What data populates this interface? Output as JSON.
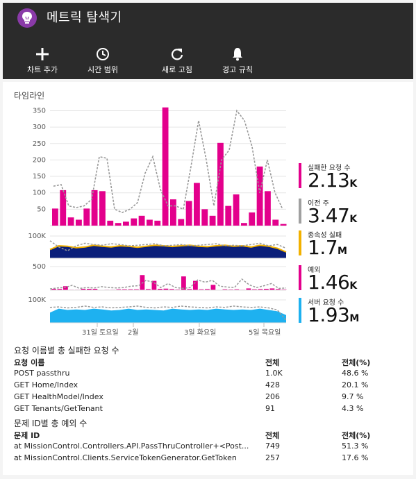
{
  "app": {
    "title": "메트릭 탐색기"
  },
  "toolbar": {
    "add_chart": "차트 추가",
    "time_range": "시간 범위",
    "refresh": "새로 고침",
    "alert_rules": "경고 규칙"
  },
  "timeline": {
    "title": "타임라인",
    "x_ticks": [
      "31일 토요일",
      "2월",
      "3일 화요일",
      "5일 목요일"
    ]
  },
  "chart_data": [
    {
      "type": "bar",
      "title": "",
      "ylim": [
        0,
        370
      ],
      "y_ticks": [
        50,
        100,
        150,
        200,
        250,
        300,
        350
      ],
      "series": [
        {
          "name": "실패한 요청 수",
          "values": [
            52,
            108,
            25,
            18,
            52,
            108,
            105,
            15,
            8,
            12,
            22,
            30,
            18,
            15,
            360,
            80,
            20,
            75,
            130,
            50,
            30,
            252,
            60,
            95,
            8,
            40,
            180,
            105,
            18,
            5
          ]
        },
        {
          "name": "이전 주",
          "values": [
            120,
            125,
            60,
            55,
            60,
            80,
            210,
            205,
            50,
            40,
            50,
            70,
            160,
            210,
            110,
            60,
            60,
            50,
            180,
            320,
            200,
            60,
            200,
            230,
            350,
            320,
            240,
            100,
            200,
            100,
            50
          ]
        }
      ]
    },
    {
      "type": "area",
      "y_ticks": [
        "100K"
      ],
      "series": [
        {
          "name": "종속성 실패",
          "values": [
            35,
            50,
            48,
            42,
            45,
            52,
            48,
            45,
            50,
            48,
            44,
            48,
            52,
            50,
            47,
            50,
            52,
            48,
            46,
            50,
            52,
            48,
            50,
            45,
            52,
            48,
            40,
            25
          ]
        },
        {
          "name": "이전 주",
          "values": [
            70,
            45,
            30,
            50,
            60,
            55,
            52,
            58,
            55,
            50,
            52,
            55,
            58,
            50,
            52,
            55,
            50,
            52,
            55,
            58,
            50,
            52,
            50,
            55,
            60,
            50,
            55,
            40
          ]
        }
      ]
    },
    {
      "type": "bar",
      "y_ticks": [
        "500"
      ],
      "series": [
        {
          "name": "예외",
          "values": [
            30,
            28,
            90,
            10,
            10,
            30,
            30,
            30,
            8,
            10,
            10,
            20,
            20,
            20,
            20,
            340,
            25,
            210,
            30,
            35,
            25,
            15,
            310,
            25,
            210,
            20,
            25,
            120,
            8,
            20,
            15,
            20,
            10,
            40,
            20,
            25,
            30,
            40,
            25,
            15
          ]
        },
        {
          "name": "이전 주",
          "values": [
            30,
            50,
            60,
            110,
            40,
            60,
            50,
            80,
            60,
            50,
            60,
            90,
            100,
            220,
            180,
            60,
            150,
            60,
            40,
            60,
            230,
            180,
            220,
            90,
            70,
            60,
            250,
            120,
            60,
            100,
            150,
            40,
            50
          ]
        }
      ]
    },
    {
      "type": "area",
      "y_ticks": [
        "100K"
      ],
      "series": [
        {
          "name": "서버 요청 수",
          "values": [
            40,
            55,
            50,
            52,
            50,
            55,
            52,
            48,
            50,
            55,
            50,
            52,
            50,
            48,
            55,
            52,
            50,
            52,
            50,
            55,
            52,
            50,
            52,
            50,
            55,
            50,
            45,
            30
          ]
        },
        {
          "name": "이전 주",
          "values": [
            60,
            62,
            58,
            60,
            65,
            60,
            62,
            58,
            60,
            62,
            65,
            60,
            58,
            62,
            60,
            65,
            62,
            60,
            58,
            62,
            60,
            65,
            62,
            60,
            62,
            58,
            50,
            10
          ]
        }
      ]
    }
  ],
  "kpis": [
    {
      "label": "실패한 요청 수",
      "value": "2.13",
      "unit": "K",
      "color": "#e3008c"
    },
    {
      "label": "이전 주",
      "value": "3.47",
      "unit": "K",
      "color": "#a0a0a0"
    },
    {
      "label": "종속성 실패",
      "value": "1.7",
      "unit": "M",
      "color": "#f2b100"
    },
    {
      "label": "예외",
      "value": "1.46",
      "unit": "K",
      "color": "#e3008c"
    },
    {
      "label": "서버 요청 수",
      "value": "1.93",
      "unit": "M",
      "color": "#1eb1f0"
    }
  ],
  "failed_requests": {
    "title": "요청 이름별 총 실패한 요청 수",
    "headers": [
      "요청 이름",
      "전체",
      "전체(%)"
    ],
    "rows": [
      [
        "POST passthru",
        "1.0K",
        "48.6 %"
      ],
      [
        "GET Home/Index",
        "428",
        "20.1 %"
      ],
      [
        "GET HealthModel/Index",
        "206",
        "9.7 %"
      ],
      [
        "GET Tenants/GetTenant",
        "91",
        "4.3 %"
      ]
    ]
  },
  "exceptions": {
    "title": "문제 ID별 총 예외 수",
    "headers": [
      "문제 ID",
      "전체",
      "전체(%)"
    ],
    "rows": [
      [
        "at MissionControl.Controllers.API.PassThruController+<Post...",
        "749",
        "51.3 %"
      ],
      [
        "at MissionControl.Clients.ServiceTokenGenerator.GetToken",
        "257",
        "17.6 %"
      ]
    ]
  },
  "colors": {
    "magenta": "#e3008c",
    "navy": "#0b1f7a",
    "gold": "#f2b100",
    "cyan": "#1eb1f0",
    "prev_week": "#999999"
  }
}
